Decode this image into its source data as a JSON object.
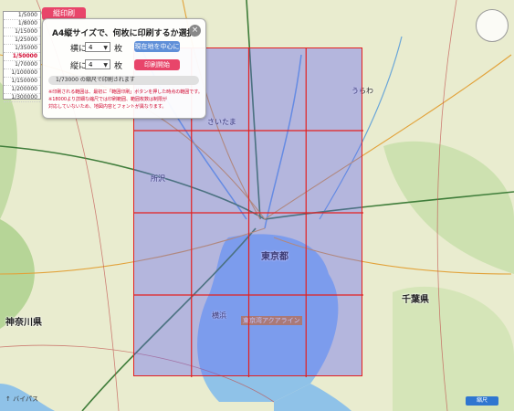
{
  "map": {
    "prefectures": [
      "東京都",
      "神奈川県",
      "千葉県"
    ],
    "places": [
      {
        "name": "さいたま",
        "pos": "tl"
      },
      {
        "name": "所沢",
        "pos": "l"
      },
      {
        "name": "東京湾アクアライン",
        "pos": "c"
      },
      {
        "name": "横浜",
        "pos": "bl"
      },
      {
        "name": "うらわ",
        "pos": "t"
      }
    ],
    "expressway_label": "バイパス"
  },
  "top_tab": "縦印刷",
  "scale_list": [
    "1/5000",
    "1/8000",
    "1/15000",
    "1/25000",
    "1/35000",
    "1/50000",
    "1/70000",
    "1/100000",
    "1/150000",
    "1/200000",
    "1/300000"
  ],
  "scale_active_index": 5,
  "dialog": {
    "title": "A4縦サイズで、何枚に印刷するか選択",
    "rows": [
      {
        "label": "横に",
        "value": "4",
        "unit": "枚"
      },
      {
        "label": "縦に",
        "value": "4",
        "unit": "枚"
      }
    ],
    "center_button": "現在地を中心に",
    "print_button": "印刷開始",
    "scale_note": "1/73000 の縮尺で印刷されます",
    "notes": [
      "※印刷される範囲は、最初に「範囲印刷」ボタンを押した時点の範囲です。",
      "※18000より詳細な縮尺では印刷範囲、範囲枚数は制限が",
      "対応していないため、地図内容とフォントが異なります。"
    ]
  },
  "grid": {
    "cols": 4,
    "rows": 4
  },
  "bottom_left_text": "↑ バイパス",
  "bottom_button": "縮尺"
}
